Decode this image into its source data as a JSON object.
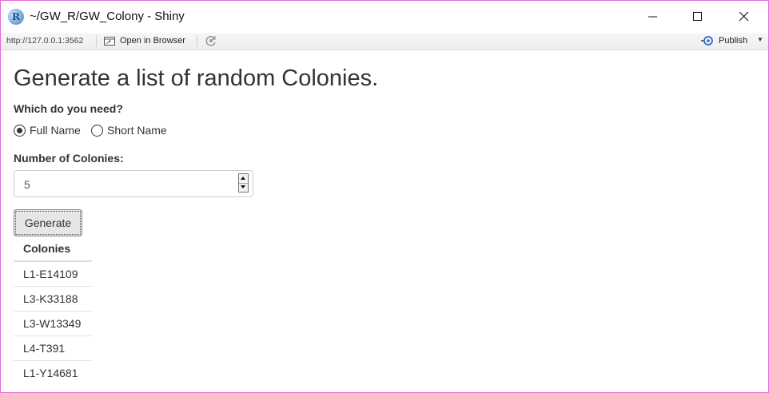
{
  "window": {
    "title": "~/GW_R/GW_Colony - Shiny",
    "app_icon": "R"
  },
  "toolbar": {
    "url": "http://127.0.0.1:3562",
    "open_in_browser": "Open in Browser",
    "publish": "Publish"
  },
  "app": {
    "title": "Generate a list of random Colonies.",
    "question_label": "Which do you need?",
    "radio_options": [
      {
        "label": "Full Name",
        "selected": true
      },
      {
        "label": "Short Name",
        "selected": false
      }
    ],
    "number_label": "Number of Colonies:",
    "number_value": "5",
    "generate_button": "Generate",
    "table": {
      "header": "Colonies",
      "rows": [
        "L1-E14109",
        "L3-K33188",
        "L3-W13349",
        "L4-T391",
        "L1-Y14681"
      ]
    }
  },
  "colors": {
    "window_border": "#e46bd3",
    "publish_icon": "#2b6cc4",
    "text": "#333333"
  }
}
